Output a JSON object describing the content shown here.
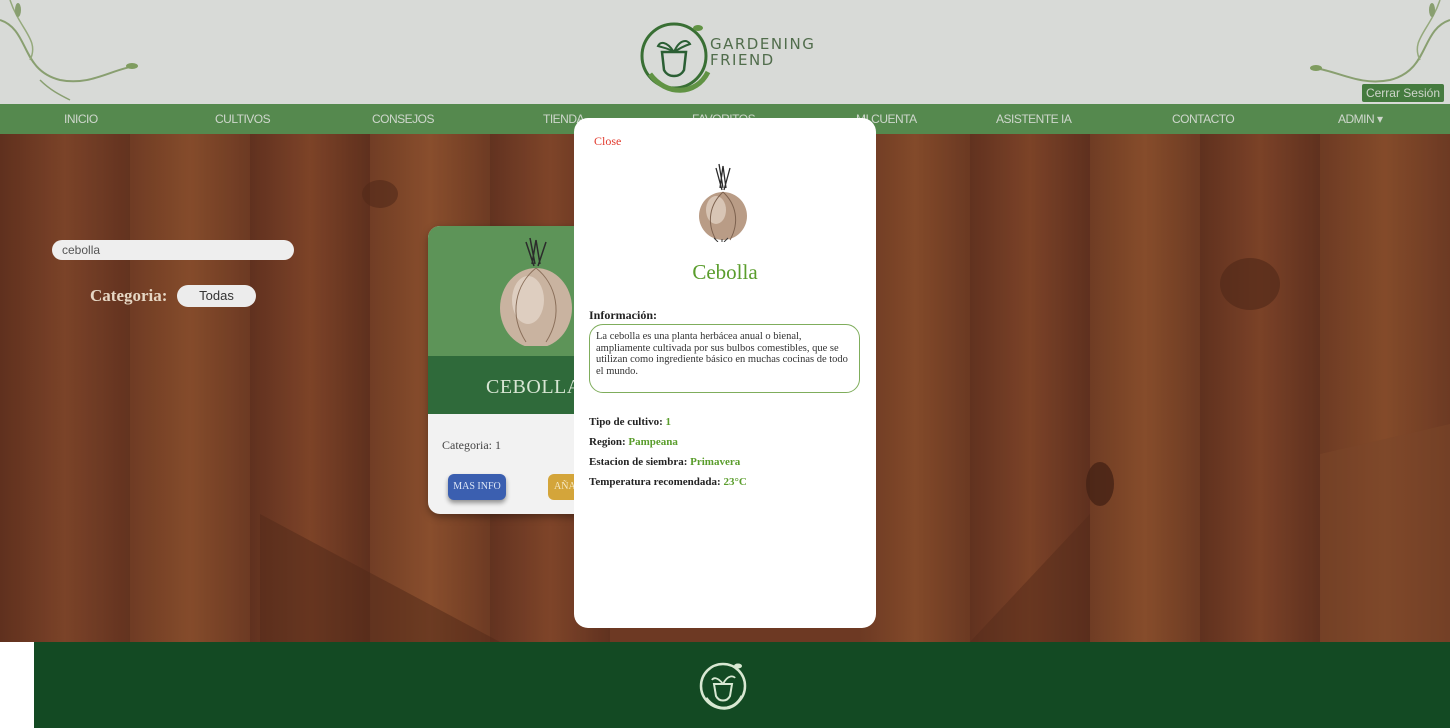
{
  "header": {
    "brand_line1": "GARDENING",
    "brand_line2": "FRIEND",
    "logout_label": "Cerrar Sesión"
  },
  "nav": {
    "items": [
      {
        "label": "INICIO"
      },
      {
        "label": "CULTIVOS"
      },
      {
        "label": "CONSEJOS"
      },
      {
        "label": "TIENDA"
      },
      {
        "label": "FAVORITOS"
      },
      {
        "label": "MI CUENTA"
      },
      {
        "label": "ASISTENTE IA"
      },
      {
        "label": "CONTACTO"
      },
      {
        "label": "ADMIN ▾"
      }
    ]
  },
  "filters": {
    "search_value": "cebolla",
    "category_label": "Categoria:",
    "category_selected": "Todas"
  },
  "card": {
    "title": "CEBOLLA",
    "category_text": "Categoria: 1",
    "info_button": "MAS INFO",
    "add_button": "AÑADIR"
  },
  "modal": {
    "close_label": "Close",
    "title": "Cebolla",
    "info_heading": "Información:",
    "info_text": "La cebolla es una planta herbácea anual o bienal, ampliamente cultivada por sus bulbos comestibles, que se utilizan como ingrediente básico en muchas cocinas de todo el mundo.",
    "details": [
      {
        "label": "Tipo de cultivo:",
        "value": "1"
      },
      {
        "label": "Region:",
        "value": "Pampeana"
      },
      {
        "label": "Estacion de siembra:",
        "value": "Primavera"
      },
      {
        "label": "Temperatura recomendada:",
        "value": "23°C"
      }
    ]
  },
  "colors": {
    "nav_green": "#5f9a57",
    "footer_green": "#134a23",
    "accent_green": "#5a9d2c",
    "close_red": "#e23b2e",
    "info_button_blue": "#3b5fb0",
    "add_button_gold": "#d4a53a"
  }
}
